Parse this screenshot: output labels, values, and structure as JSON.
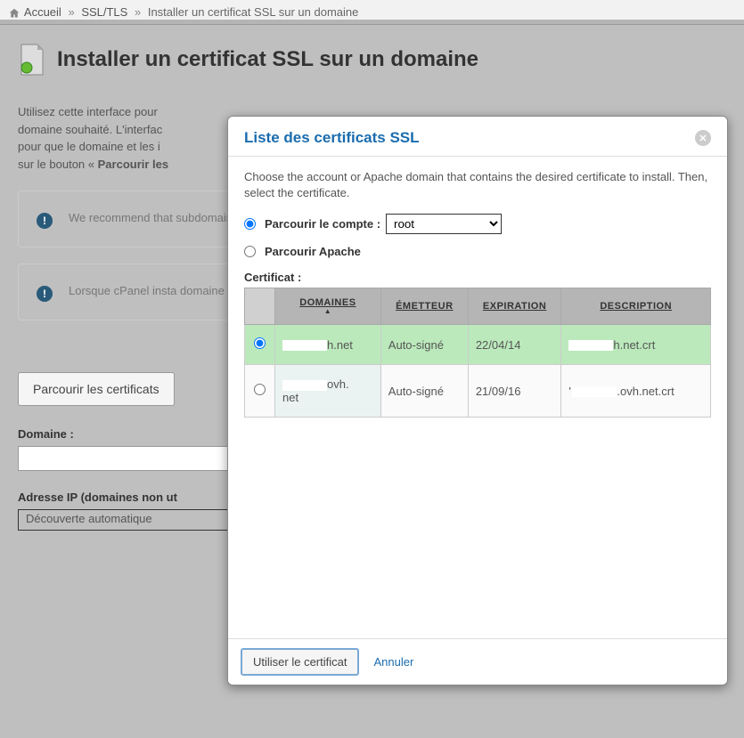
{
  "breadcrumb": {
    "home": "Accueil",
    "mid": "SSL/TLS",
    "current": "Installer un certificat SSL sur un domaine"
  },
  "page": {
    "title": "Installer un certificat SSL sur un domaine",
    "intro_part1": "Utilisez cette interface pour ",
    "intro_part2": "domaine souhaité. L'interfac",
    "intro_part3": "pour que le domaine et les i",
    "intro_part4": "sur le bouton « ",
    "intro_strong": "Parcourir les",
    "notice1": "We recommend that subdomains, or addo default document roo even if you enable jai",
    "notice2": "Lorsque cPanel insta domaine et inversem apparaîtra comme se",
    "browse_btn": "Parcourir les certificats",
    "domain_label": "Domaine :",
    "domain_value": "",
    "ip_label": "Adresse IP (domaines non ut",
    "ip_value": "Découverte automatique"
  },
  "modal": {
    "title": "Liste des certificats SSL",
    "intro": "Choose the account or Apache domain that contains the desired certificate to install. Then, select the certificate.",
    "radio_account": "Parcourir le compte :",
    "radio_apache": "Parcourir Apache",
    "account_value": "root",
    "cert_label": "Certificat :",
    "headers": {
      "domains": "Domaines",
      "issuer": "Émetteur",
      "expiration": "Expiration",
      "description": "Description"
    },
    "rows": [
      {
        "domain_suffix": "h.net",
        "issuer": "Auto-signé",
        "expiration": "22/04/14",
        "desc_suffix": "h.net.crt",
        "selected": true
      },
      {
        "domain_prefix": "net",
        "domain_suffix": "ovh.",
        "issuer": "Auto-signé",
        "expiration": "21/09/16",
        "desc_suffix": ".ovh.net.crt",
        "selected": false
      }
    ],
    "use_btn": "Utiliser le certificat",
    "cancel": "Annuler"
  }
}
